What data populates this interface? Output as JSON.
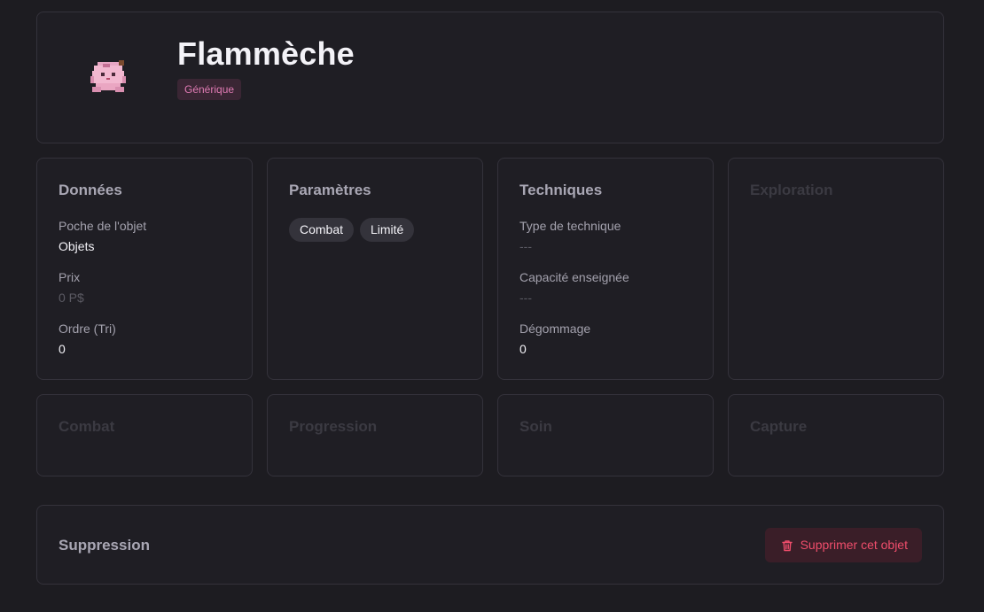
{
  "header": {
    "title": "Flammèche",
    "badge": "Générique",
    "sprite_icon": "pink-pokemon-sprite-icon"
  },
  "donnees": {
    "title": "Données",
    "fields": [
      {
        "label": "Poche de l'objet",
        "value": "Objets"
      },
      {
        "label": "Prix",
        "value": "0 P$"
      },
      {
        "label": "Ordre (Tri)",
        "value": "0"
      }
    ]
  },
  "parametres": {
    "title": "Paramètres",
    "chips": [
      "Combat",
      "Limité"
    ]
  },
  "techniques": {
    "title": "Techniques",
    "fields": [
      {
        "label": "Type de technique",
        "value": "---"
      },
      {
        "label": "Capacité enseignée",
        "value": "---"
      },
      {
        "label": "Dégommage",
        "value": "0"
      }
    ]
  },
  "exploration": {
    "title": "Exploration"
  },
  "combat": {
    "title": "Combat"
  },
  "progression": {
    "title": "Progression"
  },
  "soin": {
    "title": "Soin"
  },
  "capture": {
    "title": "Capture"
  },
  "suppression": {
    "title": "Suppression",
    "delete_label": "Supprimer cet objet",
    "delete_icon": "trash-icon"
  },
  "colors": {
    "background": "#1d1c21",
    "card_border": "#34323b",
    "badge_bg": "#3a2634",
    "badge_text": "#e07bb4",
    "danger_bg": "#3a1e28",
    "danger_text": "#ef4d6b"
  }
}
